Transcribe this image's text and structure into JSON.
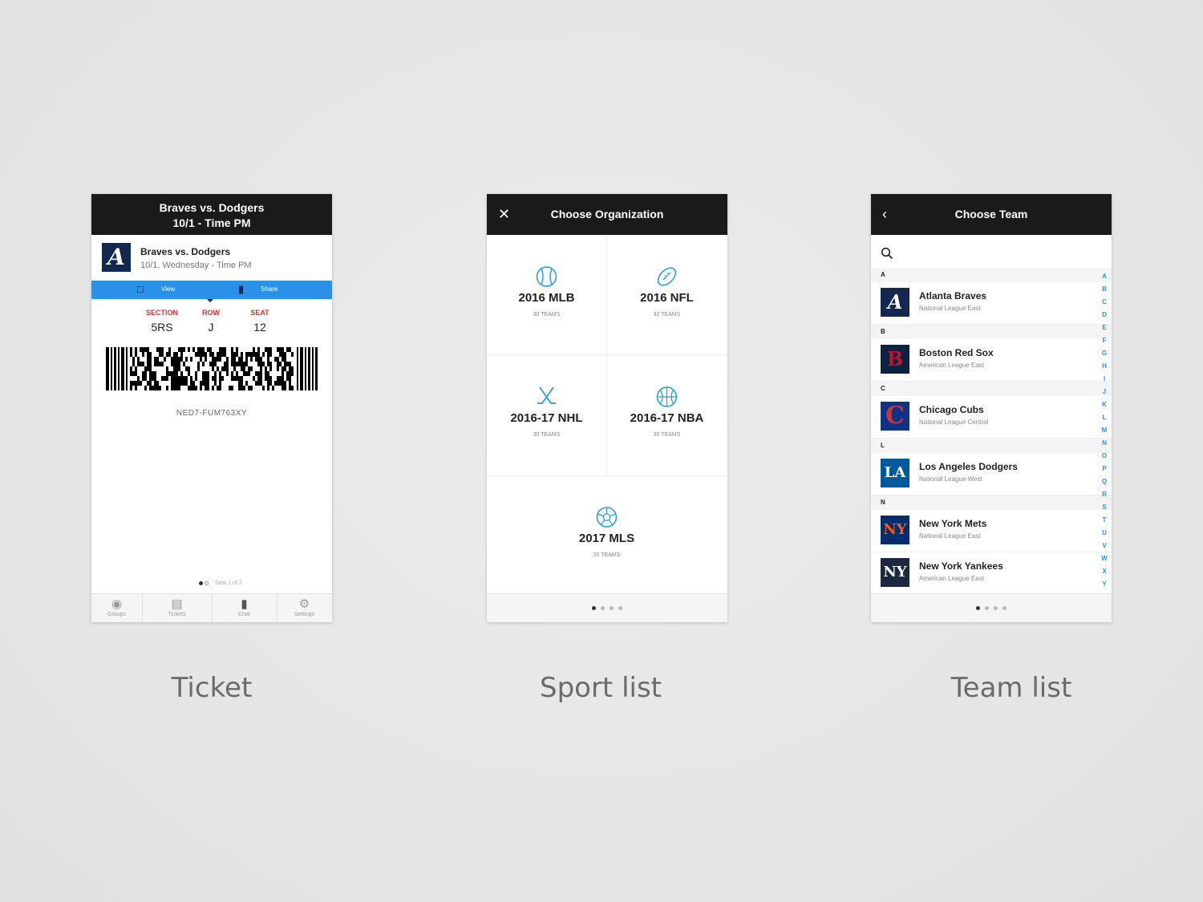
{
  "captions": {
    "ticket": "Ticket",
    "sport": "Sport list",
    "team": "Team list"
  },
  "ticket": {
    "header_line1": "Braves vs. Dodgers",
    "header_line2": "10/1 - Time PM",
    "event_title": "Braves vs. Dodgers",
    "event_date": "10/1, Wednesday - Time PM",
    "view_label": "View",
    "share_label": "Share",
    "section_label": "SECTION",
    "section_value": "5RS",
    "row_label": "ROW",
    "row_value": "J",
    "seat_label": "SEAT",
    "seat_value": "12",
    "code": "NED7-FUM763XY",
    "pager": "Seat 1 of 2",
    "tabs": [
      "Groups",
      "Tickets",
      "Chat",
      "Settings"
    ],
    "colors": {
      "accent": "#2a91e8",
      "brand": "#13274f",
      "label_red": "#d9342b"
    }
  },
  "sport": {
    "title": "Choose Organization",
    "orgs": [
      {
        "name": "2016 MLB",
        "count": "30 TEAMS",
        "icon": "baseball-icon"
      },
      {
        "name": "2016 NFL",
        "count": "32 TEAMS",
        "icon": "football-icon"
      },
      {
        "name": "2016-17 NHL",
        "count": "30 TEAMS",
        "icon": "hockey-sticks-icon"
      },
      {
        "name": "2016-17 NBA",
        "count": "30 TEAMS",
        "icon": "basketball-icon"
      },
      {
        "name": "2017 MLS",
        "count": "20 TEAMS",
        "icon": "soccer-ball-icon"
      }
    ]
  },
  "team": {
    "title": "Choose Team",
    "sections": [
      "A",
      "B",
      "C",
      "L",
      "N"
    ],
    "teams": [
      {
        "name": "Atlanta Braves",
        "league": "National League East"
      },
      {
        "name": "Boston Red Sox",
        "league": "American League East"
      },
      {
        "name": "Chicago Cubs",
        "league": "National League Central"
      },
      {
        "name": "Los Angeles Dodgers",
        "league": "National League West"
      },
      {
        "name": "New York Mets",
        "league": "National League East"
      },
      {
        "name": "New York Yankees",
        "league": "American League East"
      }
    ],
    "logos": [
      "A",
      "B",
      "C",
      "LA",
      "NY",
      "NY"
    ],
    "alphabet": [
      "A",
      "B",
      "C",
      "D",
      "E",
      "F",
      "G",
      "H",
      "I",
      "J",
      "K",
      "L",
      "M",
      "N",
      "O",
      "P",
      "Q",
      "R",
      "S",
      "T",
      "U",
      "V",
      "W",
      "X",
      "Y"
    ]
  }
}
